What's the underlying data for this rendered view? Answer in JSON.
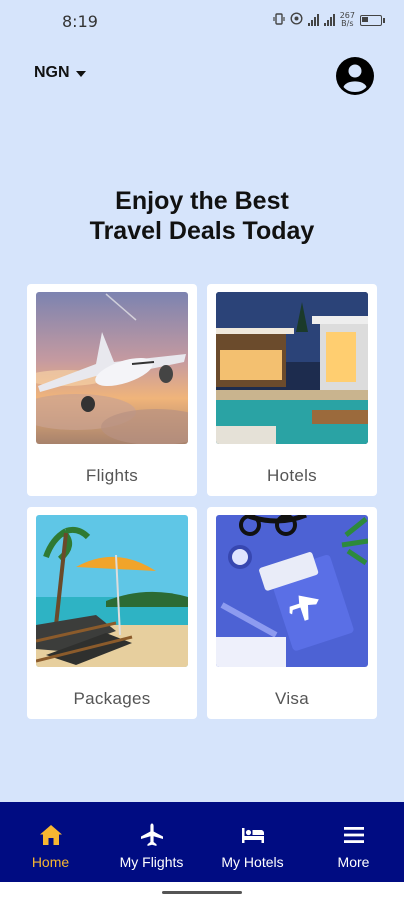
{
  "status_bar": {
    "time": "8:19",
    "net_speed_value": "267",
    "net_speed_unit": "B/s"
  },
  "header": {
    "currency": "NGN"
  },
  "headline": {
    "line1": "Enjoy the Best",
    "line2": "Travel Deals Today"
  },
  "services": [
    {
      "label": "Flights",
      "icon": "airplane-photo"
    },
    {
      "label": "Hotels",
      "icon": "hotel-pool-photo"
    },
    {
      "label": "Packages",
      "icon": "beach-photo"
    },
    {
      "label": "Visa",
      "icon": "passport-photo"
    }
  ],
  "bottom_nav": [
    {
      "label": "Home",
      "icon": "home-icon",
      "active": true
    },
    {
      "label": "My Flights",
      "icon": "airplane-icon",
      "active": false
    },
    {
      "label": "My Hotels",
      "icon": "bed-icon",
      "active": false
    },
    {
      "label": "More",
      "icon": "menu-icon",
      "active": false
    }
  ],
  "colors": {
    "background": "#d6e4fb",
    "nav_bg": "#000c82",
    "active": "#f7b731",
    "inactive": "#ffffff"
  }
}
